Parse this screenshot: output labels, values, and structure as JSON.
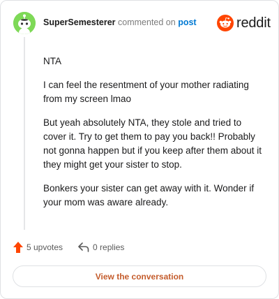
{
  "header": {
    "username": "SuperSemesterer",
    "action_text": "commented on",
    "post_link": "post"
  },
  "brand": {
    "wordmark": "reddit",
    "logo_icon": "reddit-snoo-icon",
    "color": "#ff4500"
  },
  "avatar": {
    "icon": "snoo-avatar-icon",
    "color": "#7ed957"
  },
  "comment": {
    "paragraphs": [
      "NTA",
      "I can feel the resentment of your mother radiating from my screen lmao",
      "But yeah absolutely NTA, they stole and tried to cover it. Try to get them to pay you back!! Probably not gonna happen but if you keep after them about it they might get your sister to stop.",
      "Bonkers your sister can get away with it. Wonder if your mom was aware already."
    ]
  },
  "actions": {
    "upvotes": "5 upvotes",
    "upvote_icon": "upvote-arrow-icon",
    "upvote_color": "#ff4500",
    "replies": "0 replies",
    "reply_icon": "reply-arrow-icon"
  },
  "footer": {
    "view_conversation": "View the conversation",
    "accent": "#c45c2c"
  }
}
